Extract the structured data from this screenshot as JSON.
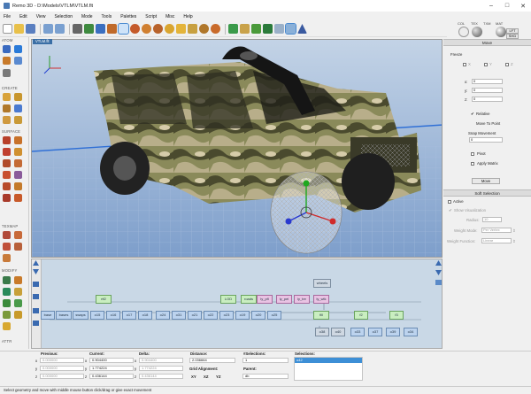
{
  "window": {
    "title": "Remo 3D - D:\\Models\\VTLM\\VTLM.flt"
  },
  "menu": [
    "File",
    "Edit",
    "View",
    "Selection",
    "Mode",
    "Tools",
    "Palettes",
    "Script",
    "Misc",
    "Help"
  ],
  "toolbar": {
    "icons": [
      "new-file-icon",
      "open-folder-icon",
      "save-icon",
      "undo-icon",
      "redo-icon",
      "select-icon",
      "move-tool-icon",
      "paint-icon",
      "shape-icon",
      "move-mode-icon",
      "fruit-icon",
      "fruit-icon",
      "fruit-icon",
      "fruit-icon",
      "star-icon",
      "gear-icon",
      "fruit-icon",
      "fruit-icon",
      "cube-green-icon",
      "cross-icon",
      "tree-icon",
      "tree-icon",
      "grid-icon",
      "view-icon",
      "triangle-icon"
    ]
  },
  "material_panel": {
    "labels": [
      "COL",
      "TEX",
      "TXM",
      "MAT"
    ],
    "buttons": [
      "LFT",
      "SHD"
    ]
  },
  "left_panel": {
    "sections": [
      "ATOM",
      "CREATE",
      "SURFACE",
      "TEXMAP",
      "MODIFY",
      "ATTR"
    ]
  },
  "viewport": {
    "tab": "VTLM.flt"
  },
  "graph_nodes": [
    {
      "label": "wheels",
      "kind": "k"
    },
    {
      "label": "rtf2",
      "kind": "g"
    },
    {
      "label": "LOD",
      "kind": "g"
    },
    {
      "label": "roads",
      "kind": "g"
    },
    {
      "label": "ly_pfl",
      "kind": "p"
    },
    {
      "label": "ly_pel",
      "kind": "p"
    },
    {
      "label": "ly_tre",
      "kind": "p"
    },
    {
      "label": "ly_wlk",
      "kind": "p"
    },
    {
      "label": "base",
      "kind": "b"
    },
    {
      "label": "bases",
      "kind": "b"
    },
    {
      "label": "swaps",
      "kind": "b"
    },
    {
      "label": "o15",
      "kind": "b"
    },
    {
      "label": "o16",
      "kind": "b"
    },
    {
      "label": "o17",
      "kind": "b"
    },
    {
      "label": "o18",
      "kind": "b"
    },
    {
      "label": "o24",
      "kind": "b"
    },
    {
      "label": "o31",
      "kind": "b"
    },
    {
      "label": "o21",
      "kind": "b"
    },
    {
      "label": "o22",
      "kind": "b"
    },
    {
      "label": "o23",
      "kind": "b"
    },
    {
      "label": "o19",
      "kind": "b"
    },
    {
      "label": "o20",
      "kind": "b"
    },
    {
      "label": "o25",
      "kind": "b"
    },
    {
      "label": "fill",
      "kind": "g"
    },
    {
      "label": "f2",
      "kind": "g"
    },
    {
      "label": "f3",
      "kind": "g"
    },
    {
      "label": "o38",
      "kind": "k"
    },
    {
      "label": "o40",
      "kind": "k"
    },
    {
      "label": "o33",
      "kind": "b"
    },
    {
      "label": "o37",
      "kind": "b"
    },
    {
      "label": "o39",
      "kind": "b"
    },
    {
      "label": "o34",
      "kind": "b"
    }
  ],
  "right_panel": {
    "move": {
      "title": "Move",
      "freeze": "Freeze",
      "axes": [
        "X",
        "Y",
        "Z"
      ],
      "x_label": "x:",
      "x_value": "0",
      "y_label": "y:",
      "y_value": "0",
      "z_label": "z:",
      "z_value": "0",
      "relative": "Relative",
      "move_to_point": "Move To Point",
      "snap_label": "Snap Movement",
      "snap_value": "0",
      "pivot": "Pivot",
      "apply_matrix": "Apply Matrix",
      "move_button": "Move"
    },
    "soft": {
      "title": "Soft Selection",
      "active": "Active",
      "show_vis": "Show Visualization",
      "radius_label": "Radius:",
      "radius_value": "10",
      "weight_mode_label": "Weight Mode:",
      "weight_mode_value": "Per Vertex",
      "weight_fn_label": "Weight Function:",
      "weight_fn_value": "Linear"
    }
  },
  "bottom": {
    "previous": {
      "label": "Previous:",
      "x": "0.000000",
      "y": "0.000000",
      "z": "0.000000"
    },
    "current": {
      "label": "Current:",
      "x": "0.904400",
      "y": "1.774224",
      "z": "0.436144"
    },
    "delta": {
      "label": "Delta:",
      "x": "0.904400",
      "y": "1.774224",
      "z": "0.436144"
    },
    "distance_label": "Distance:",
    "distance_value": "2.036664",
    "grid_label": "Grid Alignment:",
    "grid_buttons": [
      "XY",
      "XZ",
      "YZ"
    ],
    "nsel_label": "#Selections:",
    "nsel_value": "1",
    "parent_label": "Parent:",
    "parent_value": "db",
    "sel_label": "Selections:",
    "sel_value": "o42",
    "axis_letters": [
      "x",
      "y",
      "z"
    ]
  },
  "status": "Select geometry and move with middle mouse button click/drag or give exact movement",
  "colors": {
    "selection": "#3d8fd6",
    "viewport_sky_top": "#c4d4e8",
    "node_blue": "#bcd3ee",
    "node_green": "#c9eec0",
    "node_pink": "#e9c3e3"
  }
}
